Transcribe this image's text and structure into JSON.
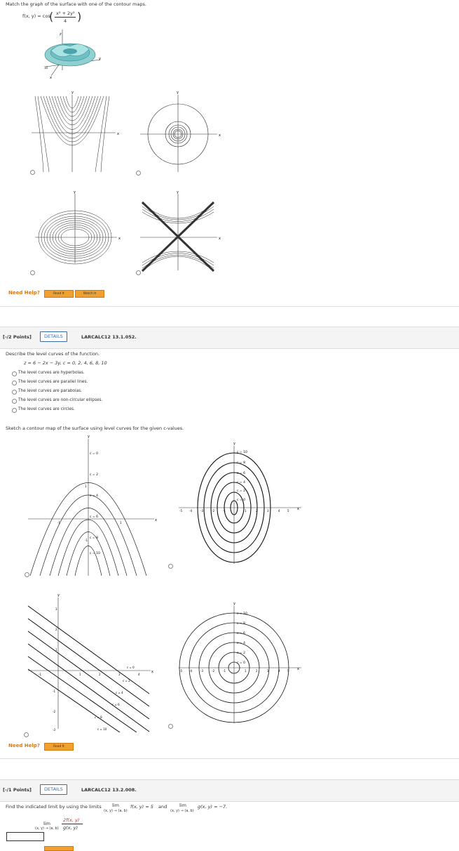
{
  "q1": {
    "instruction": "Match the graph of the surface with one of the contour maps.",
    "function": "f(x, y) = cos",
    "func_numerator": "x² + 2y²",
    "func_denominator": "4",
    "need_help": "Need Help?",
    "read_it": "Read It",
    "watch_it": "Watch It",
    "surface_labels": {
      "z": "z",
      "y": "y",
      "x": "x",
      "z_tick": "10"
    },
    "axis_x": "x",
    "axis_y": "y"
  },
  "q2": {
    "points": "[-/2 Points]",
    "details": "DETAILS",
    "code": "LARCALC12 13.1.052.",
    "prompt": "Describe the level curves of the function.",
    "equation": "z = 6 − 2x − 3y,    c = 0, 2, 4, 6, 8, 10",
    "options": [
      "The level curves are hyperbolas.",
      "The level curves are parallel lines.",
      "The level curves are parabolas.",
      "The level curves are non-circular ellipses.",
      "The level curves are circles."
    ],
    "sketch_prompt": "Sketch a contour map of the surface using level curves for the given c-values.",
    "need_help": "Need Help?",
    "read_it": "Read It",
    "parabola_labels": [
      "c = 0",
      "c = 2",
      "c = 4",
      "c = 6",
      "c = 8",
      "c = 10"
    ],
    "ellipse_labels": [
      "c = 10",
      "c = 8",
      "c = 6",
      "c = 4",
      "c = 2",
      "c = 0"
    ],
    "line_labels": [
      "c = 10",
      "c = 8",
      "c = 6",
      "c = 4",
      "c = 2",
      "c = 0"
    ],
    "circle_labels": [
      "c = 10",
      "c = 8",
      "c = 6",
      "c = 4",
      "c = 2",
      "c = 0"
    ]
  },
  "q3": {
    "points": "[-/1 Points]",
    "details": "DETAILS",
    "code": "LARCALC12 13.2.008.",
    "prompt": "Find the indicated limit by using the limits",
    "lim": "lim",
    "sub": "(x, y) → (a, b)",
    "f_expr": "f(x, y) = 5",
    "and": "and",
    "g_expr": "g(x, y) = −7.",
    "frac_num": "2f(x, y)",
    "frac_den": "g(x, y)"
  }
}
